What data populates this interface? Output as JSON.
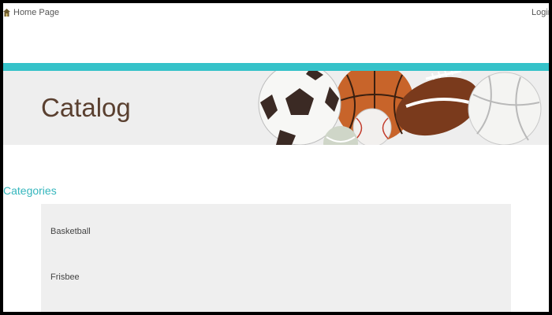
{
  "nav": {
    "home_label": "Home Page",
    "login_label": "Login"
  },
  "hero": {
    "title": "Catalog"
  },
  "categories": {
    "heading": "Categories",
    "items": [
      {
        "label": "Basketball"
      },
      {
        "label": "Frisbee"
      }
    ]
  },
  "colors": {
    "accent": "#35c2c9",
    "heading_accent": "#35b6bd",
    "title_brown": "#5a4030",
    "panel_gray": "#efefef"
  },
  "icons": {
    "home": "home-icon"
  }
}
